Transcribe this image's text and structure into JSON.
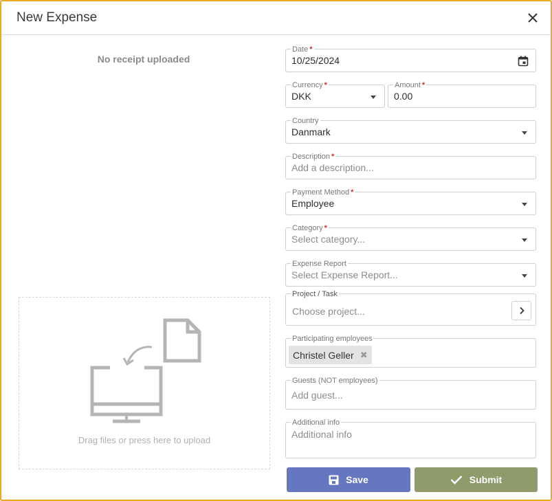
{
  "dialog": {
    "title": "New Expense",
    "close_icon": "close-icon"
  },
  "receipt": {
    "status": "No receipt uploaded",
    "upload_text": "Drag files or press here to upload",
    "upload_icon": "upload-to-computer-icon"
  },
  "form": {
    "date": {
      "label": "Date",
      "value": "10/25/2024",
      "required": true
    },
    "currency": {
      "label": "Currency",
      "value": "DKK",
      "required": true
    },
    "amount": {
      "label": "Amount",
      "value": "0.00",
      "required": true
    },
    "country": {
      "label": "Country",
      "value": "Danmark"
    },
    "description": {
      "label": "Description",
      "placeholder": "Add a description...",
      "required": true
    },
    "payment_method": {
      "label": "Payment Method",
      "value": "Employee",
      "required": true
    },
    "category": {
      "label": "Category",
      "placeholder": "Select category...",
      "required": true
    },
    "expense_report": {
      "label": "Expense Report",
      "placeholder": "Select Expense Report..."
    },
    "project": {
      "label": "Project / Task",
      "placeholder": "Choose project..."
    },
    "participants": {
      "label": "Participating employees",
      "chips": [
        "Christel Geller"
      ],
      "remove_glyph": "✖"
    },
    "guests": {
      "label": "Guests (NOT employees)",
      "placeholder": "Add guest..."
    },
    "additional": {
      "label": "Additional info",
      "placeholder": "Additional info"
    },
    "required_mark": "*"
  },
  "actions": {
    "save_label": "Save",
    "submit_label": "Submit"
  },
  "colors": {
    "border_accent": "#f0a91e",
    "save": "#6677c1",
    "submit": "#8f9b6a",
    "required": "#d42b2b"
  }
}
